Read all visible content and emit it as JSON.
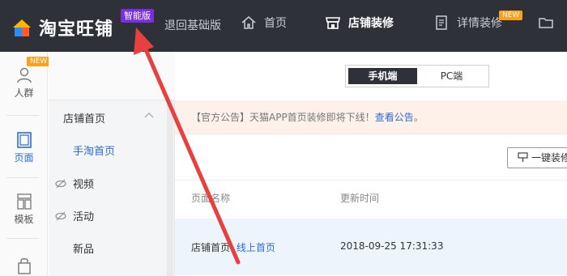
{
  "topbar": {
    "logo_text": "淘宝旺铺",
    "smart_badge": "智能版",
    "back_link": "退回基础版",
    "nav": [
      {
        "label": "首页",
        "icon": "home-icon"
      },
      {
        "label": "店铺装修",
        "icon": "store-icon",
        "active": true
      },
      {
        "label": "详情装修",
        "icon": "document-icon",
        "badge": "NEW"
      },
      {
        "label": "",
        "icon": "folder-icon"
      }
    ]
  },
  "rail": {
    "items": [
      {
        "label": "人群",
        "icon": "user-icon",
        "badge": "NEW"
      },
      {
        "label": "页面",
        "icon": "page-icon",
        "active": true
      },
      {
        "label": "模板",
        "icon": "template-icon"
      },
      {
        "label": "",
        "icon": "bag-icon"
      }
    ]
  },
  "sidebar2": {
    "group": "店铺首页",
    "sub_item": "手淘首页",
    "items": [
      {
        "label": "视频",
        "icon": "hidden-eye-icon"
      },
      {
        "label": "活动",
        "icon": "hidden-eye-icon"
      },
      {
        "label": "新品",
        "icon": ""
      }
    ]
  },
  "segment": {
    "mobile": "手机端",
    "pc": "PC端"
  },
  "notice": {
    "text": "【官方公告】天猫APP首页装修即将下线！",
    "link": "查看公告",
    "end": "。"
  },
  "decorate_button": "一键装修",
  "table": {
    "headers": {
      "name": "页面名称",
      "updated": "更新时间"
    },
    "rows": [
      {
        "name": "店铺首页",
        "status_link": "线上首页",
        "updated": "2018-09-25 17:31:33"
      }
    ]
  },
  "colors": {
    "topbar": "#2e3238",
    "accent": "#2b6cd6",
    "smart_badge": "#7b2ee0",
    "new_badge": "#ff9f1a",
    "annotation": "#e8403f"
  }
}
